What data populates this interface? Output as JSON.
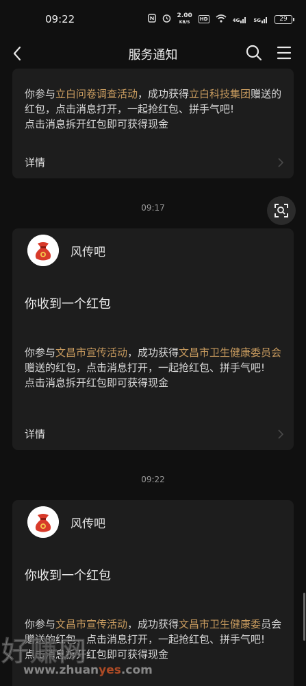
{
  "status": {
    "time": "09:22",
    "speed_value": "2.00",
    "speed_unit": "KB/S",
    "hd_label": "HD",
    "net1": "4G",
    "net2": "5G",
    "battery": "29"
  },
  "header": {
    "title": "服务通知"
  },
  "card1": {
    "body_parts": [
      "你参与",
      "立白问卷调查活动",
      "，成功获得",
      "立白科技集团",
      "赠送的红包，点击消息打开，一起抢红包、拼手气吧!"
    ],
    "line2": "点击消息拆开红包即可获得现金",
    "details": "详情"
  },
  "time2": "09:17",
  "card2": {
    "sender": "风传吧",
    "title": "你收到一个红包",
    "body_parts": [
      "你参与",
      "文昌市宣传活动",
      "，成功获得",
      "文昌市卫生健康委员会",
      "赠送的红包，点击消息打开，一起抢红包、拼手气吧!"
    ],
    "line2": "点击消息拆开红包即可获得现金",
    "details": "详情"
  },
  "time3": "09:22",
  "card3": {
    "sender": "风传吧",
    "title": "你收到一个红包",
    "body_parts": [
      "你参与",
      "文昌市宣传活动",
      "，成功获得",
      "文昌市卫生健康委",
      "员会赠送的红包，点击消息打开，一起抢红包、拼手气吧!"
    ],
    "line2": "点击消息拆开红包即可获得现金"
  },
  "watermark": {
    "text": "好赚网",
    "url_a": "www.zhuan",
    "url_b": "yes",
    "url_c": ".com"
  },
  "colors": {
    "background": "#101010",
    "card": "#1d1d1d",
    "highlight": "#c79a5e"
  }
}
